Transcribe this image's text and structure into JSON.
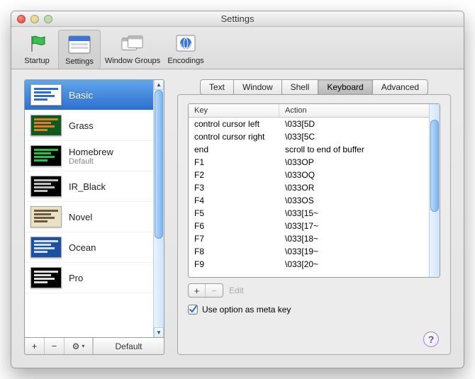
{
  "window": {
    "title": "Settings"
  },
  "toolbar": {
    "items": [
      {
        "label": "Startup"
      },
      {
        "label": "Settings"
      },
      {
        "label": "Window Groups"
      },
      {
        "label": "Encodings"
      }
    ],
    "selected": 1
  },
  "sidebar": {
    "profiles": [
      {
        "name": "Basic",
        "sub": "",
        "bg": "#ffffff",
        "fg": "#2f6bd0",
        "selected": true
      },
      {
        "name": "Grass",
        "sub": "",
        "bg": "#0e5a1f",
        "fg": "#e07c2a"
      },
      {
        "name": "Homebrew",
        "sub": "Default",
        "bg": "#000000",
        "fg": "#22c24a"
      },
      {
        "name": "IR_Black",
        "sub": "",
        "bg": "#000000",
        "fg": "#bfbfbf"
      },
      {
        "name": "Novel",
        "sub": "",
        "bg": "#e9e1c6",
        "fg": "#6b5a3b"
      },
      {
        "name": "Ocean",
        "sub": "",
        "bg": "#1e4fa0",
        "fg": "#cfe0ff"
      },
      {
        "name": "Pro",
        "sub": "",
        "bg": "#000000",
        "fg": "#dddddd"
      }
    ],
    "bottom": {
      "add": "+",
      "remove": "−",
      "gear": "⚙︎",
      "default": "Default"
    }
  },
  "tabs": {
    "items": [
      "Text",
      "Window",
      "Shell",
      "Keyboard",
      "Advanced"
    ],
    "selected": 3
  },
  "table": {
    "headers": {
      "key": "Key",
      "action": "Action"
    },
    "rows": [
      {
        "key": "control cursor left",
        "action": "\\033[5D"
      },
      {
        "key": "control cursor right",
        "action": "\\033[5C"
      },
      {
        "key": "end",
        "action": "scroll to end of buffer"
      },
      {
        "key": "F1",
        "action": "\\033OP"
      },
      {
        "key": "F2",
        "action": "\\033OQ"
      },
      {
        "key": "F3",
        "action": "\\033OR"
      },
      {
        "key": "F4",
        "action": "\\033OS"
      },
      {
        "key": "F5",
        "action": "\\033[15~"
      },
      {
        "key": "F6",
        "action": "\\033[17~"
      },
      {
        "key": "F7",
        "action": "\\033[18~"
      },
      {
        "key": "F8",
        "action": "\\033[19~"
      },
      {
        "key": "F9",
        "action": "\\033[20~"
      }
    ]
  },
  "editbar": {
    "add": "+",
    "remove": "−",
    "edit": "Edit"
  },
  "checkbox": {
    "label": "Use option as meta key",
    "checked": true
  },
  "help": {
    "glyph": "?"
  }
}
